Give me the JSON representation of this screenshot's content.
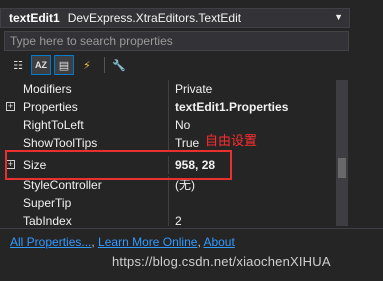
{
  "object_selector": {
    "name": "textEdit1",
    "type": "DevExpress.XtraEditors.TextEdit"
  },
  "search": {
    "placeholder": "Type here to search properties"
  },
  "toolbar": {
    "buttons": [
      {
        "icon": "categorized-icon",
        "glyph": "☷"
      },
      {
        "icon": "alphabetical-icon",
        "glyph": "AZ"
      },
      {
        "icon": "properties-icon",
        "glyph": "▤"
      },
      {
        "icon": "events-icon",
        "glyph": "⚡"
      },
      {
        "icon": "property-pages-icon",
        "glyph": "🔧"
      }
    ]
  },
  "properties": [
    {
      "name": "Modifiers",
      "value": "Private",
      "expandable": false,
      "bold": false
    },
    {
      "name": "Properties",
      "value": "textEdit1.Properties",
      "expandable": true,
      "bold": true
    },
    {
      "name": "RightToLeft",
      "value": "No",
      "expandable": false,
      "bold": false
    },
    {
      "name": "ShowToolTips",
      "value": "True",
      "expandable": false,
      "bold": false
    },
    {
      "name": "Size",
      "value": "958, 28",
      "expandable": true,
      "bold": true
    },
    {
      "name": "StyleController",
      "value": "(无)",
      "expandable": false,
      "bold": false
    },
    {
      "name": "SuperTip",
      "value": "",
      "expandable": false,
      "bold": false
    },
    {
      "name": "TabIndex",
      "value": "2",
      "expandable": false,
      "bold": false
    }
  ],
  "annotation": {
    "text": "自由设置",
    "color": "#e8312f"
  },
  "links": {
    "all_properties": "All Properties...",
    "learn_more": "Learn More Online",
    "about": "About",
    "separator": ", "
  },
  "watermark": "https://blog.csdn.net/xiaochenXIHUA",
  "colors": {
    "background": "#252526",
    "accent": "#007acc",
    "link": "#3399ff"
  }
}
